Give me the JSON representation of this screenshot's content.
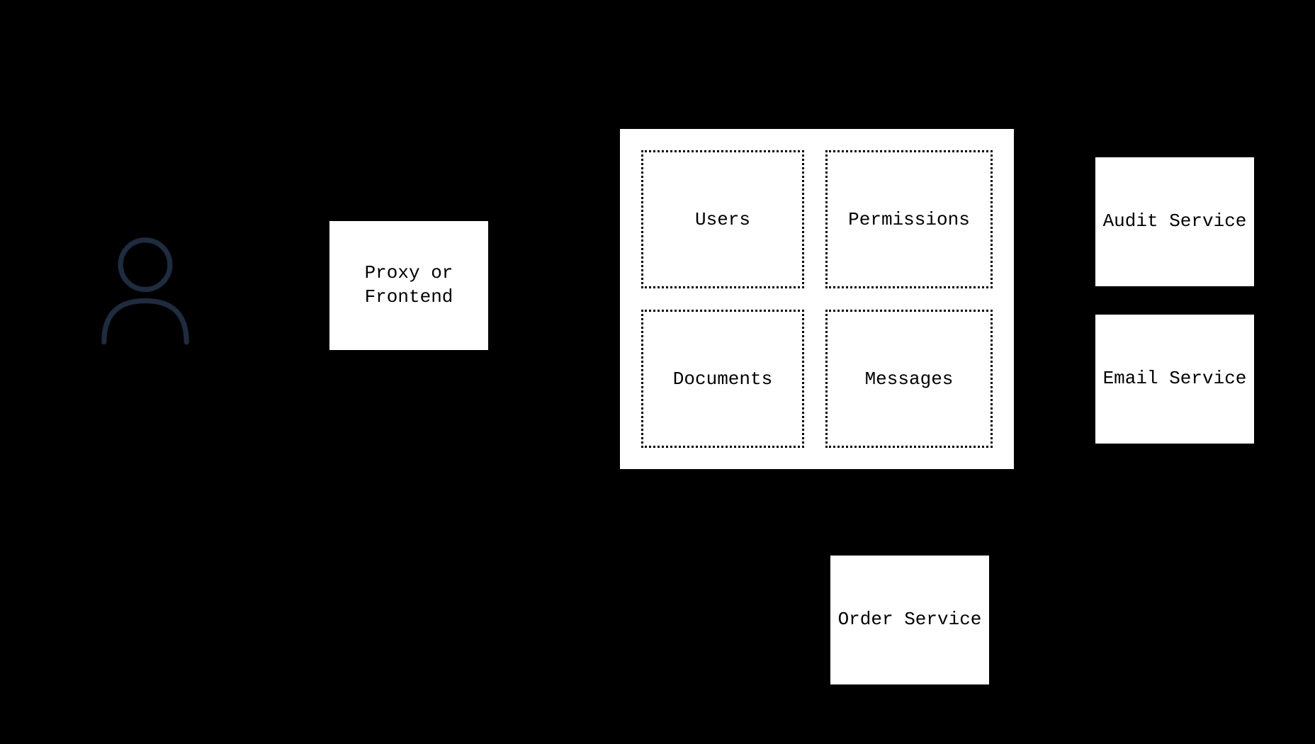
{
  "diagram": {
    "user_icon": "user-icon",
    "proxy": {
      "label": "Proxy or Frontend"
    },
    "monolith": {
      "modules": {
        "users": "Users",
        "permissions": "Permissions",
        "documents": "Documents",
        "messages": "Messages"
      }
    },
    "services": {
      "audit": "Audit Service",
      "email": "Email Service",
      "order": "Order Service"
    }
  }
}
